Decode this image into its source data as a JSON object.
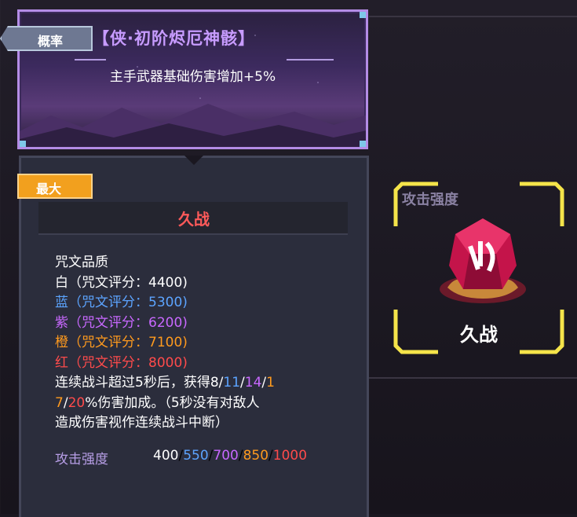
{
  "banner": {
    "tag": "概率",
    "title": "【侠·初阶烬厄神骸】",
    "description": "主手武器基础伤害增加+5%"
  },
  "panel": {
    "tag": "最大",
    "title": "久战",
    "quality_heading": "咒文品质",
    "quality_lines": [
      {
        "text": "白（咒文评分：4400)",
        "color": "#ffffff"
      },
      {
        "text": "蓝（咒文评分：5300)",
        "color": "#5ca4ff"
      },
      {
        "text": "紫（咒文评分：6200)",
        "color": "#c868ff"
      },
      {
        "text": "橙（咒文评分：7100)",
        "color": "#ff9a1e"
      },
      {
        "text": "红（咒文评分：8000)",
        "color": "#ff4b4b"
      }
    ],
    "desc_a": "连续战斗超过5秒后，获得",
    "desc_v1": "8",
    "desc_v2": "11",
    "desc_v3": "14",
    "desc_v4a": "1",
    "desc_v4b": "7",
    "desc_v5": "20",
    "desc_b": "%伤害加成。（5秒没有对敌人",
    "desc_c": "造成伤害视作连续战斗中断）",
    "stat_label": "攻击强度",
    "stat_values": [
      "400",
      "550",
      "700",
      "850",
      "1000"
    ],
    "stat_sep": "/"
  },
  "card": {
    "label": "攻击强度",
    "name": "久战",
    "frame_color": "#f5e44a",
    "icon": "rune-gem-icon"
  },
  "colors": {
    "white": "#ffffff",
    "blue": "#5ca4ff",
    "purple": "#c868ff",
    "orange": "#ff9a1e",
    "red": "#ff4b4b"
  }
}
